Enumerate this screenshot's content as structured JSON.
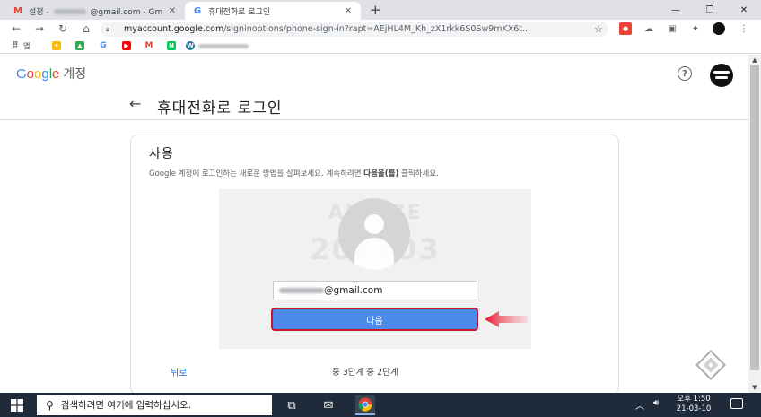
{
  "browser": {
    "tabs": [
      {
        "title_prefix": "설정 -",
        "title_suffix": "@gmail.com - Gm",
        "icon": "gmail-icon",
        "active": false
      },
      {
        "title": "휴대전화로 로그인",
        "icon": "google-icon",
        "active": true
      }
    ],
    "new_tab_label": "+",
    "window_controls": {
      "minimize": "—",
      "restore": "❐",
      "close": "✕"
    },
    "url_host": "myaccount.google.com",
    "url_path": "/signinoptions/phone-sign-in?rapt=AEjHL4M_Kh_zX1rkk6S0Sw9mKX6t...",
    "bookmarks": [
      {
        "label": "앱",
        "icon": "apps-grid-icon"
      },
      {
        "label": "",
        "icon": "pinwheel-icon"
      },
      {
        "label": "",
        "icon": "google-drive-icon"
      },
      {
        "label": "",
        "icon": "google-g-icon"
      },
      {
        "label": "",
        "icon": "youtube-icon"
      },
      {
        "label": "",
        "icon": "gmail-icon"
      },
      {
        "label": "",
        "icon": "naver-icon"
      },
      {
        "label": "",
        "icon": "wordpress-icon"
      },
      {
        "label": "- GOOD SALES..",
        "icon": "bookmark-icon"
      }
    ]
  },
  "header": {
    "logo_text": "Google",
    "logo_suffix": "계정",
    "help_symbol": "?"
  },
  "page": {
    "back_symbol": "←",
    "title": "휴대전화로 로그인"
  },
  "card": {
    "heading": "사용",
    "desc_before": "Google 계정에 로그인하는 새로운 방법을 살펴보세요. 계속하려면 ",
    "desc_bold": "다음을(를)",
    "desc_after": " 클릭하세요.",
    "watermark_line1": "ALLUZE",
    "watermark_line2": "202103",
    "email_suffix": "@gmail.com",
    "next_button": "다음",
    "back_link": "뒤로",
    "step_text": "중 3단계 중 2단계"
  },
  "taskbar": {
    "search_placeholder": "검색하려면 여기에 입력하십시오.",
    "time": "오후 1:50",
    "date": "21-03-10"
  },
  "colors": {
    "google_blue": "#4285F4",
    "google_red": "#EA4335",
    "google_yellow": "#FBBC05",
    "google_green": "#34A853",
    "button_blue": "#4d8be9",
    "highlight_red": "#c5162d",
    "taskbar": "#1f2b3a"
  }
}
